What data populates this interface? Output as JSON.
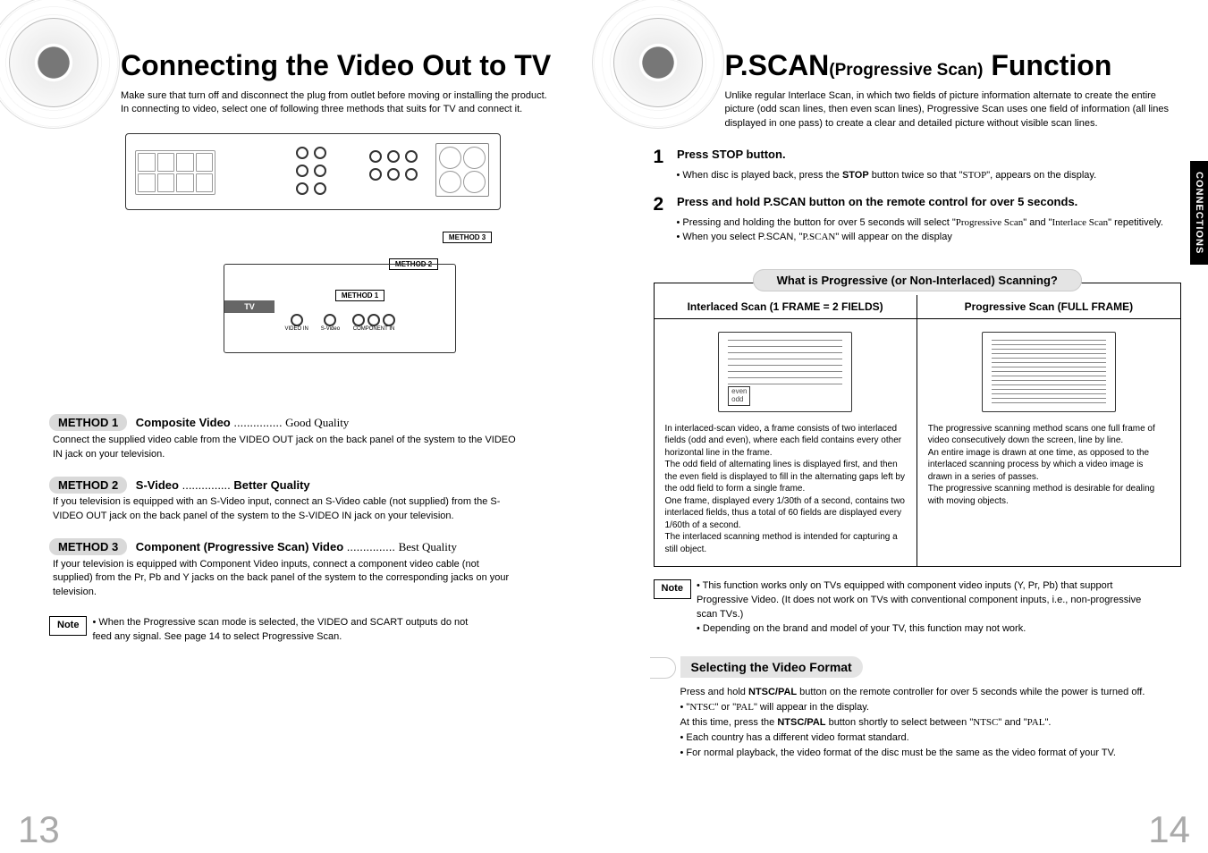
{
  "left": {
    "title": "Connecting the Video Out to TV",
    "intro": "Make sure that turn off and disconnect the plug from outlet before moving or installing the product.\nIn connecting to video, select one of following three methods that suits for TV and connect it.",
    "diagram": {
      "tag3": "METHOD 3",
      "tag2": "METHOD 2",
      "tag1": "METHOD 1",
      "tv": "TV",
      "video_in": "VIDEO IN",
      "svideo": "S-Video",
      "component_in": "COMPONENT IN"
    },
    "m1": {
      "badge": "METHOD 1",
      "name": "Composite Video",
      "dots": " ............... ",
      "quality": "Good Quality",
      "desc": "Connect the supplied video cable from the VIDEO OUT jack on the back panel of the system to the VIDEO IN jack on your television."
    },
    "m2": {
      "badge": "METHOD 2",
      "name": "S-Video",
      "dots": " ............... ",
      "quality": "Better Quality",
      "desc": "If you television is equipped with an S-Video input, connect an S-Video cable (not supplied) from the S-VIDEO OUT jack on the back panel of the system to the S-VIDEO IN jack on your television."
    },
    "m3": {
      "badge": "METHOD 3",
      "name": "Component (Progressive Scan) Video",
      "dots": " ............... ",
      "quality": "Best Quality",
      "desc": "If your television is equipped with Component Video inputs, connect a component video cable (not supplied) from the Pr, Pb and Y jacks on the back panel of the system to the corresponding jacks on your television."
    },
    "note_label": "Note",
    "note": "When the Progressive scan mode is selected, the VIDEO and SCART outputs do not feed any signal. See page 14 to select Progressive Scan.",
    "pagenum": "13"
  },
  "right": {
    "title_a": "P.SCAN",
    "title_b": "(Progressive Scan)",
    "title_c": " Function",
    "intro": "Unlike regular Interlace Scan, in which two fields of picture information alternate to create the entire picture (odd scan lines, then even scan lines), Progressive Scan uses one field of information (all lines displayed in one pass) to create a clear and detailed picture without visible scan lines.",
    "sidebar": "CONNECTIONS",
    "s1": {
      "num": "1",
      "title": "Press STOP button.",
      "b1a": "When disc is played back, press the ",
      "b1b": "STOP",
      "b1c": " button twice so that \"",
      "b1d": "STOP",
      "b1e": "\", appears on the display."
    },
    "s2": {
      "num": "2",
      "title": "Press and hold P.SCAN button on the remote control for over 5 seconds.",
      "b1a": "Pressing and holding the button for over 5 seconds will select \"",
      "b1b": "Progressive Scan",
      "b1c": "\" and \"",
      "b1d": "Interlace Scan",
      "b1e": "\" repetitively.",
      "b2a": "When you select P.SCAN, \"",
      "b2b": "P.SCAN",
      "b2c": "\" will appear on the display"
    },
    "whatbox": {
      "title": "What is Progressive (or Non-Interlaced) Scanning?",
      "h_left": "Interlaced Scan (1 FRAME = 2 FIELDS)",
      "h_right": "Progressive Scan (FULL FRAME)",
      "even": "even",
      "odd": "odd",
      "left_text": "In interlaced-scan video, a frame consists of two interlaced fields (odd and even), where each field contains every other horizontal line in the frame.\nThe odd field of alternating lines is displayed first, and then the even field is displayed to fill in the alternating gaps left by the odd field to form a single frame.\nOne frame, displayed every 1/30th of a second, contains two interlaced fields, thus a total of 60 fields are displayed every 1/60th of a second.\nThe interlaced scanning method is intended for capturing a still object.",
      "right_text": "The progressive scanning method scans one full frame of video consecutively down the screen, line by line.\nAn entire image is drawn at one time, as opposed to the interlaced scanning process by which a video image is drawn in a series of passes.\nThe progressive scanning method is desirable for dealing with moving objects."
    },
    "note_label": "Note",
    "note1": "This function works only on TVs equipped with component video inputs (Y, Pr, Pb) that support Progressive Video. (It does not work on TVs with conventional component inputs, i.e., non-progressive scan TVs.)",
    "note2": "Depending on the brand and model of your TV, this function may not work.",
    "vf": {
      "head": "Selecting the Video Format",
      "lead_a": "Press and hold ",
      "lead_b": "NTSC/PAL",
      "lead_c": " button on the remote controller for over 5 seconds while the power is turned off.",
      "b1a": "\"",
      "b1b": "NTSC",
      "b1c": "\" or \"",
      "b1d": "PAL",
      "b1e": "\" will appear in the display.",
      "b1f_a": "At this time, press the ",
      "b1f_b": "NTSC/PAL",
      "b1f_c": " button shortly to select between \"",
      "b1f_d": "NTSC",
      "b1f_e": "\" and \"",
      "b1f_f": "PAL",
      "b1f_g": "\".",
      "b2": "Each country has a different video format standard.",
      "b3": "For normal playback, the video format of the disc must be the same as the video format of your TV."
    },
    "pagenum": "14"
  }
}
